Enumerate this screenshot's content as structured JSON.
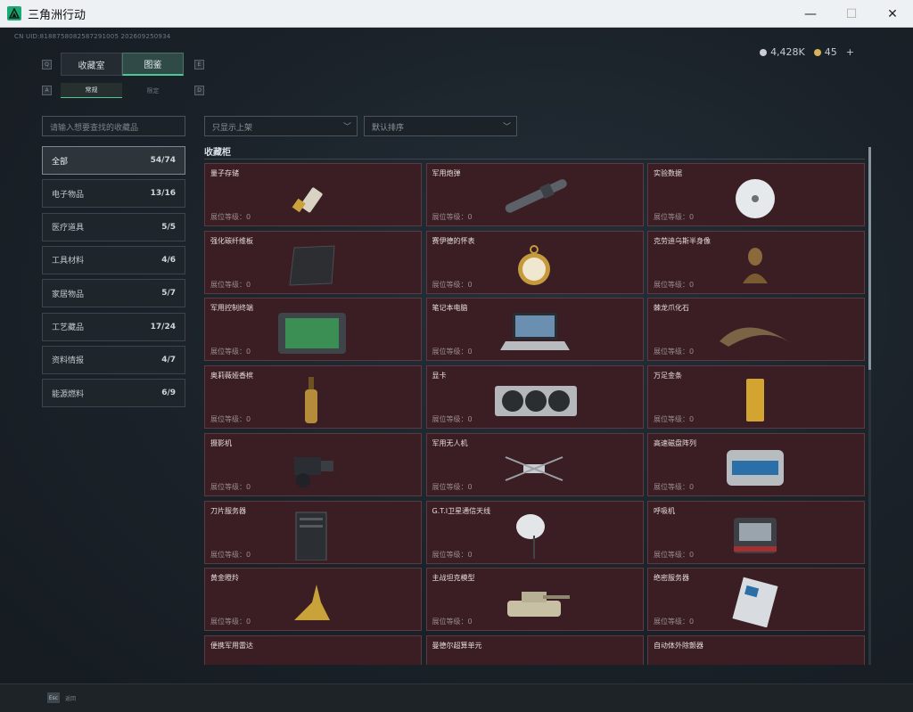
{
  "window": {
    "title": "三角洲行动",
    "minimize": "—",
    "maximize": "☐",
    "close": "✕"
  },
  "uid": "CN UID:8188758082587291005 202609250934",
  "currency": {
    "silver": "4,428K",
    "gold": "45",
    "plus": "+",
    "silver_color": "#c9cfd4",
    "gold_color": "#d8b35a"
  },
  "keys": {
    "q": "Q",
    "e": "E",
    "a": "A",
    "d": "D"
  },
  "tabs": [
    "收藏室",
    "图鉴"
  ],
  "subtabs": [
    "常规",
    "限定"
  ],
  "search_placeholder": "请输入想要查找的收藏品",
  "categories": [
    {
      "label": "全部",
      "count": "54/74"
    },
    {
      "label": "电子物品",
      "count": "13/16"
    },
    {
      "label": "医疗道具",
      "count": "5/5"
    },
    {
      "label": "工具材料",
      "count": "4/6"
    },
    {
      "label": "家居物品",
      "count": "5/7"
    },
    {
      "label": "工艺藏品",
      "count": "17/24"
    },
    {
      "label": "资料情报",
      "count": "4/7"
    },
    {
      "label": "能源燃料",
      "count": "6/9"
    }
  ],
  "filters": {
    "show": "只显示上架",
    "sort": "默认排序",
    "chevron": "﹀"
  },
  "section_title": "收藏柜",
  "level_prefix": "展位等级：",
  "items": [
    {
      "name": "量子存储",
      "level": "0",
      "icon": "usb-drive-icon"
    },
    {
      "name": "军用炮弹",
      "level": "0",
      "icon": "artillery-shell-icon"
    },
    {
      "name": "实验数据",
      "level": "0",
      "icon": "disc-icon"
    },
    {
      "name": "强化碳纤维板",
      "level": "0",
      "icon": "carbon-plate-icon"
    },
    {
      "name": "赛伊德的怀表",
      "level": "0",
      "icon": "pocket-watch-icon"
    },
    {
      "name": "克劳迪乌斯半身像",
      "level": "0",
      "icon": "bust-icon"
    },
    {
      "name": "军用控制终端",
      "level": "0",
      "icon": "terminal-icon"
    },
    {
      "name": "笔记本电脑",
      "level": "0",
      "icon": "laptop-icon"
    },
    {
      "name": "棘龙爪化石",
      "level": "0",
      "icon": "claw-fossil-icon"
    },
    {
      "name": "奥莉薇娅香槟",
      "level": "0",
      "icon": "champagne-icon"
    },
    {
      "name": "显卡",
      "level": "0",
      "icon": "graphics-card-icon"
    },
    {
      "name": "万足金条",
      "level": "0",
      "icon": "gold-bar-icon"
    },
    {
      "name": "摄影机",
      "level": "0",
      "icon": "camera-icon"
    },
    {
      "name": "军用无人机",
      "level": "0",
      "icon": "drone-icon"
    },
    {
      "name": "高速磁盘阵列",
      "level": "0",
      "icon": "disk-array-icon"
    },
    {
      "name": "刀片服务器",
      "level": "0",
      "icon": "blade-server-icon"
    },
    {
      "name": "G.T.I卫星通信天线",
      "level": "0",
      "icon": "satellite-dish-icon"
    },
    {
      "name": "呼吸机",
      "level": "0",
      "icon": "ventilator-icon"
    },
    {
      "name": "黄金瞪羚",
      "level": "0",
      "icon": "gold-gazelle-icon"
    },
    {
      "name": "主战坦克模型",
      "level": "0",
      "icon": "tank-model-icon"
    },
    {
      "name": "绝密服务器",
      "level": "0",
      "icon": "secret-server-icon"
    },
    {
      "name": "便携军用雷达",
      "level": "",
      "icon": "radar-icon"
    },
    {
      "name": "曼德尔超算单元",
      "level": "",
      "icon": "supercompute-icon"
    },
    {
      "name": "自动体外除颤器",
      "level": "",
      "icon": "defibrillator-icon"
    }
  ],
  "esc": {
    "key": "Esc",
    "label": "返回"
  }
}
